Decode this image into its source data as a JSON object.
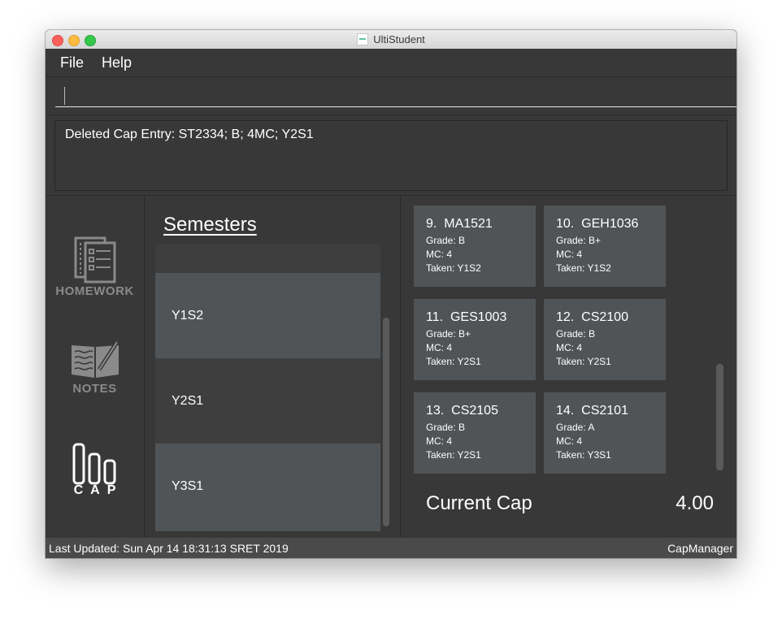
{
  "window": {
    "title": "UltiStudent"
  },
  "menu": {
    "file": "File",
    "help": "Help"
  },
  "command": {
    "value": "",
    "placeholder": ""
  },
  "result": {
    "text": "Deleted Cap Entry: ST2334; B; 4MC; Y2S1"
  },
  "sidebar": {
    "homework": {
      "label": "HOMEWORK",
      "icon": "homework-icon"
    },
    "notes": {
      "label": "NOTES",
      "icon": "notes-icon"
    },
    "cap": {
      "label": "CAP",
      "icon": "cap-icon"
    }
  },
  "semesters": {
    "title": "Semesters",
    "items": [
      {
        "label": ""
      },
      {
        "label": "Y1S2"
      },
      {
        "label": "Y2S1"
      },
      {
        "label": "Y3S1"
      }
    ]
  },
  "modules": [
    {
      "index": "9.",
      "code": "MA1521",
      "grade": "Grade: B",
      "mc": "MC: 4",
      "taken": "Taken: Y1S2"
    },
    {
      "index": "10.",
      "code": "GEH1036",
      "grade": "Grade: B+",
      "mc": "MC: 4",
      "taken": "Taken: Y1S2"
    },
    {
      "index": "11.",
      "code": "GES1003",
      "grade": "Grade: B+",
      "mc": "MC: 4",
      "taken": "Taken: Y2S1"
    },
    {
      "index": "12.",
      "code": "CS2100",
      "grade": "Grade: B",
      "mc": "MC: 4",
      "taken": "Taken: Y2S1"
    },
    {
      "index": "13.",
      "code": "CS2105",
      "grade": "Grade: B",
      "mc": "MC: 4",
      "taken": "Taken: Y2S1"
    },
    {
      "index": "14.",
      "code": "CS2101",
      "grade": "Grade: A",
      "mc": "MC: 4",
      "taken": "Taken: Y3S1"
    }
  ],
  "cap": {
    "label": "Current Cap",
    "value": "4.00"
  },
  "status": {
    "last_updated": "Last Updated: Sun Apr 14 18:31:13 SRET 2019",
    "manager": "CapManager"
  },
  "colors": {
    "background": "#383838",
    "card": "#505456",
    "semester_row_light": "#505456",
    "semester_row_dark": "#3e3e3e",
    "status_bar": "#4a4a4a"
  }
}
